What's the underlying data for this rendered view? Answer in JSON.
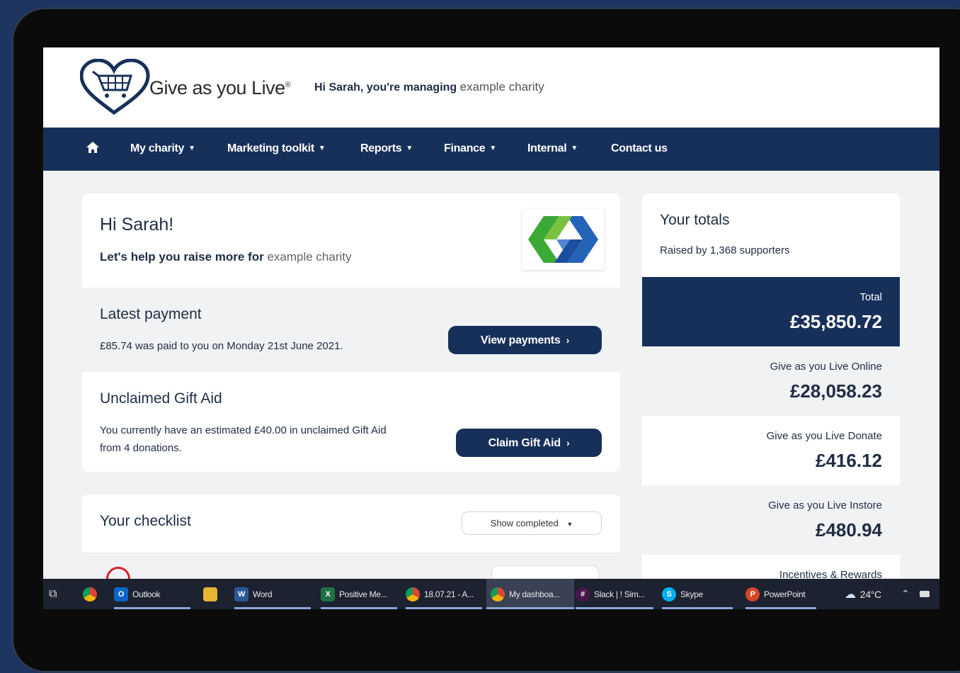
{
  "header": {
    "logo_text": "Give as you Live",
    "logo_mark": "®",
    "greeting": "Hi Sarah, you're managing",
    "charity_name": "example charity"
  },
  "nav": {
    "items": [
      {
        "label": "My charity",
        "dropdown": true
      },
      {
        "label": "Marketing toolkit",
        "dropdown": true
      },
      {
        "label": "Reports",
        "dropdown": true
      },
      {
        "label": "Finance",
        "dropdown": true
      },
      {
        "label": "Internal",
        "dropdown": true
      },
      {
        "label": "Contact us",
        "dropdown": false
      }
    ],
    "home_icon": "home-icon"
  },
  "welcome": {
    "title": "Hi Sarah!",
    "subtitle": "Let's help you raise more for",
    "charity_name": "example charity"
  },
  "latest_payment": {
    "title": "Latest payment",
    "text": "£85.74 was paid to you on Monday 21st June 2021.",
    "button": "View payments"
  },
  "gift_aid": {
    "title": "Unclaimed Gift Aid",
    "text_line1": "You currently have an estimated £40.00 in unclaimed Gift Aid",
    "text_line2": "from 4 donations.",
    "button": "Claim Gift Aid"
  },
  "checklist": {
    "title": "Your checklist",
    "filter": "Show completed"
  },
  "totals": {
    "title": "Your totals",
    "subtitle": "Raised by 1,368 supporters",
    "rows": [
      {
        "label": "Total",
        "value": "£35,850.72"
      },
      {
        "label": "Give as you Live Online",
        "value": "£28,058.23"
      },
      {
        "label": "Give as you Live Donate",
        "value": "£416.12"
      },
      {
        "label": "Give as you Live Instore",
        "value": "£480.94"
      },
      {
        "label": "Incentives & Rewards",
        "value": ""
      }
    ]
  },
  "taskbar": {
    "items": [
      "Outlook",
      "Word",
      "Positive Me...",
      "18.07.21 - A...",
      "My dashboa...",
      "Slack | ! Sim...",
      "Skype",
      "PowerPoint"
    ],
    "temperature": "24°C"
  },
  "colors": {
    "navy": "#17305a",
    "frame": "#1d3461",
    "logo_green": "#3aa935",
    "logo_blue": "#2563b8"
  }
}
